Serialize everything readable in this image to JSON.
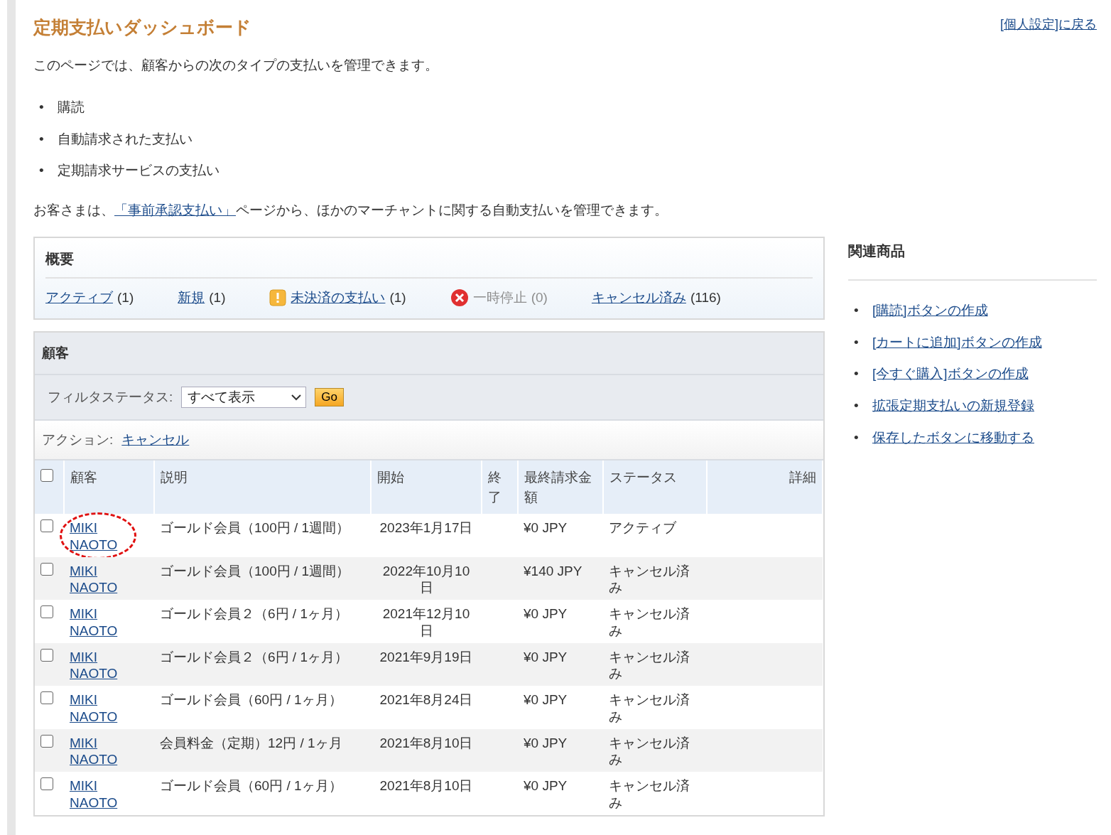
{
  "title": "定期支払いダッシュボード",
  "back_link": "[個人設定]に戻る",
  "intro": "このページでは、顧客からの次のタイプの支払いを管理できます。",
  "payment_types": [
    {
      "bullet": "•",
      "text": "購読"
    },
    {
      "bullet": "•",
      "text": "自動請求された支払い"
    },
    {
      "bullet": "•",
      "text": "定期請求サービスの支払い"
    }
  ],
  "note": {
    "before": "お客さまは、",
    "link": "「事前承認支払い」",
    "after": "ページから、ほかのマーチャントに関する自動支払いを管理できます。"
  },
  "summary": {
    "title": "概要",
    "items": [
      {
        "label": "アクティブ",
        "count": "(1)",
        "kind": "plain",
        "disabled": false
      },
      {
        "label": "新規",
        "count": "(1)",
        "kind": "plain",
        "disabled": false
      },
      {
        "label": "未決済の支払い",
        "count": "(1)",
        "kind": "warning",
        "disabled": false
      },
      {
        "label": "一時停止",
        "count": "(0)",
        "kind": "error",
        "disabled": true
      },
      {
        "label": "キャンセル済み",
        "count": "(116)",
        "kind": "plain",
        "disabled": false
      }
    ]
  },
  "customers": {
    "title": "顧客",
    "filter_label": "フィルタステータス:",
    "filter_value": "すべて表示",
    "go_button": "Go",
    "action_label": "アクション:",
    "action_link": "キャンセル",
    "table": {
      "select_all": {
        "checked": false
      },
      "columns": [
        "顧客",
        "説明",
        "開始",
        "終了",
        "最終請求金額",
        "ステータス",
        "詳細"
      ],
      "rows": [
        {
          "checked": false,
          "circled": true,
          "customer": "MIKI NAOTO",
          "description": "ゴールド会員（100円 / 1週間）",
          "start": "2023年1月17日",
          "amount": "¥0 JPY",
          "status": "アクティブ"
        },
        {
          "checked": false,
          "circled": false,
          "customer": "MIKI NAOTO",
          "description": "ゴールド会員（100円 / 1週間）",
          "start": "2022年10月10日",
          "amount": "¥140 JPY",
          "status": "キャンセル済み"
        },
        {
          "checked": false,
          "circled": false,
          "customer": "MIKI NAOTO",
          "description": "ゴールド会員２（6円 / 1ヶ月）",
          "start": "2021年12月10日",
          "amount": "¥0 JPY",
          "status": "キャンセル済み"
        },
        {
          "checked": false,
          "circled": false,
          "customer": "MIKI NAOTO",
          "description": "ゴールド会員２（6円 / 1ヶ月）",
          "start": "2021年9月19日",
          "amount": "¥0 JPY",
          "status": "キャンセル済み"
        },
        {
          "checked": false,
          "circled": false,
          "customer": "MIKI NAOTO",
          "description": "ゴールド会員（60円 / 1ヶ月）",
          "start": "2021年8月24日",
          "amount": "¥0 JPY",
          "status": "キャンセル済み"
        },
        {
          "checked": false,
          "circled": false,
          "customer": "MIKI NAOTO",
          "description": "会員料金（定期）12円 / 1ヶ月",
          "start": "2021年8月10日",
          "amount": "¥0 JPY",
          "status": "キャンセル済み"
        },
        {
          "checked": false,
          "circled": false,
          "customer": "MIKI NAOTO",
          "description": "ゴールド会員（60円 / 1ヶ月）",
          "start": "2021年8月10日",
          "amount": "¥0 JPY",
          "status": "キャンセル済み"
        }
      ]
    }
  },
  "related": {
    "title": "関連商品",
    "links": [
      {
        "bullet": "•",
        "text": "[購読]ボタンの作成"
      },
      {
        "bullet": "•",
        "text": "[カートに追加]ボタンの作成"
      },
      {
        "bullet": "•",
        "text": "[今すぐ購入]ボタンの作成"
      },
      {
        "bullet": "•",
        "text": "拡張定期支払いの新規登録"
      },
      {
        "bullet": "•",
        "text": "保存したボタンに移動する"
      }
    ]
  }
}
